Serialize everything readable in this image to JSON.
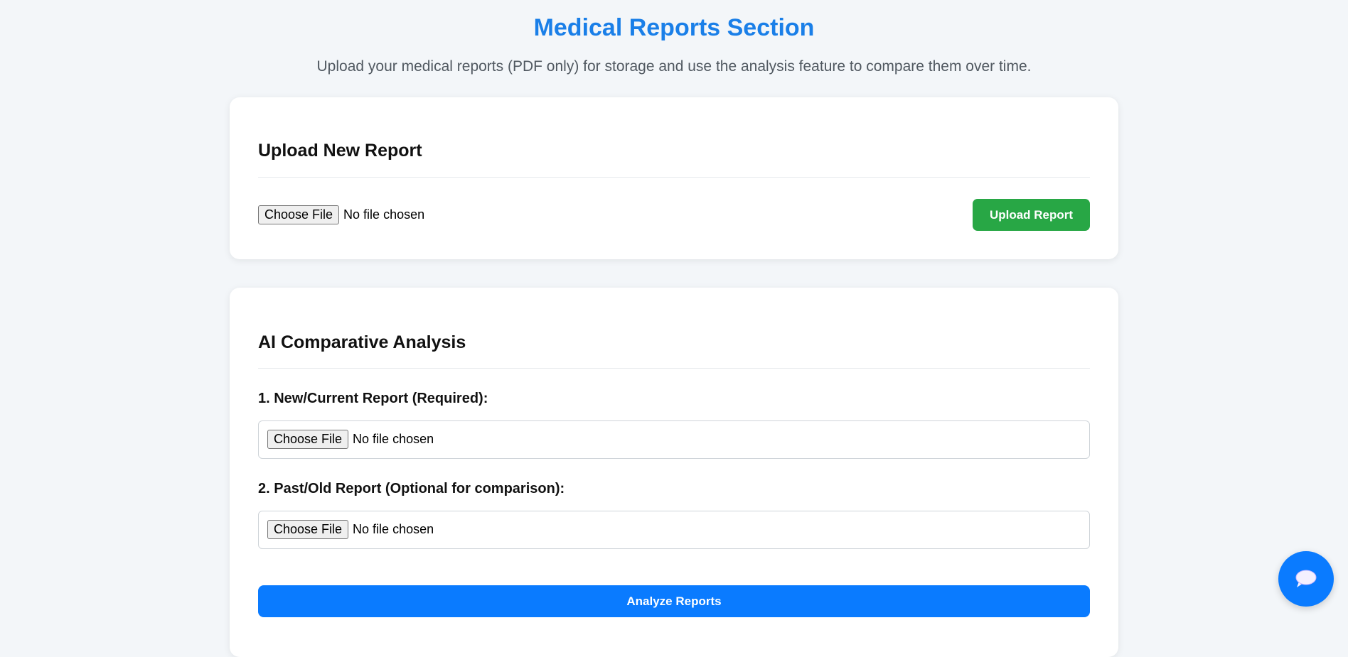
{
  "header": {
    "title": "Medical Reports Section",
    "subtitle": "Upload your medical reports (PDF only) for storage and use the analysis feature to compare them over time."
  },
  "upload_card": {
    "heading": "Upload New Report",
    "choose_file_label": "Choose File",
    "file_status": "No file chosen",
    "upload_button": "Upload Report"
  },
  "analysis_card": {
    "heading": "AI Comparative Analysis",
    "new_report_label": "1. New/Current Report (Required):",
    "new_report_choose_label": "Choose File",
    "new_report_status": "No file chosen",
    "past_report_label": "2. Past/Old Report (Optional for comparison):",
    "past_report_choose_label": "Choose File",
    "past_report_status": "No file chosen",
    "analyze_button": "Analyze Reports"
  },
  "chat": {
    "icon": "chat-bubble-icon"
  },
  "colors": {
    "title": "#1a7fe8",
    "upload_button": "#28a745",
    "analyze_button": "#0a7bff",
    "chat_button": "#0a7bff",
    "background": "#f3f6f9"
  }
}
